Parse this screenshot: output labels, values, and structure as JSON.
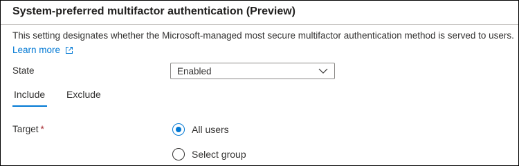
{
  "section": {
    "title": "System-preferred multifactor authentication (Preview)",
    "description": "This setting designates whether the Microsoft-managed most secure multifactor authentication method is served to users.",
    "learn_more": "Learn more"
  },
  "state": {
    "label": "State",
    "selected": "Enabled"
  },
  "tabs": [
    {
      "label": "Include",
      "selected": true
    },
    {
      "label": "Exclude",
      "selected": false
    }
  ],
  "target": {
    "label": "Target",
    "required_marker": "*",
    "options": [
      {
        "label": "All users",
        "checked": true
      },
      {
        "label": "Select group",
        "checked": false
      }
    ]
  },
  "colors": {
    "accent": "#0078d4",
    "required": "#a4262c",
    "text": "#323130"
  }
}
